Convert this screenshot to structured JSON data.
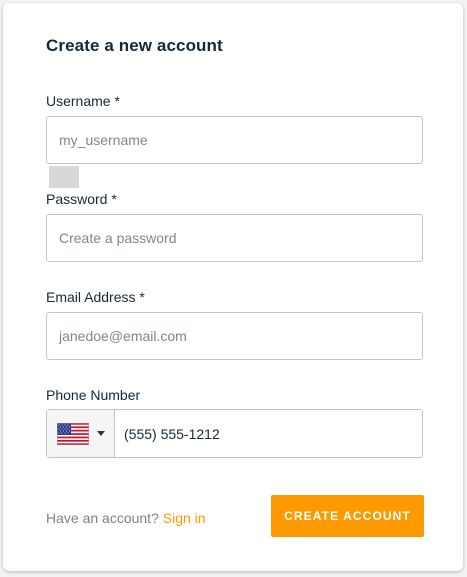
{
  "form": {
    "title": "Create a new account",
    "username": {
      "label": "Username *",
      "placeholder": "my_username",
      "value": ""
    },
    "password": {
      "label": "Password *",
      "placeholder": "Create a password",
      "value": ""
    },
    "email": {
      "label": "Email Address *",
      "placeholder": "janedoe@email.com",
      "value": ""
    },
    "phone": {
      "label": "Phone Number",
      "country_icon": "us-flag-icon",
      "value": "(555) 555-1212"
    },
    "footer": {
      "prompt": "Have an account?",
      "signin_label": "Sign in"
    },
    "submit_label": "CREATE ACCOUNT"
  },
  "colors": {
    "accent": "#ff9900",
    "text": "#152939",
    "muted": "#828282",
    "border": "#c4c4c4"
  }
}
